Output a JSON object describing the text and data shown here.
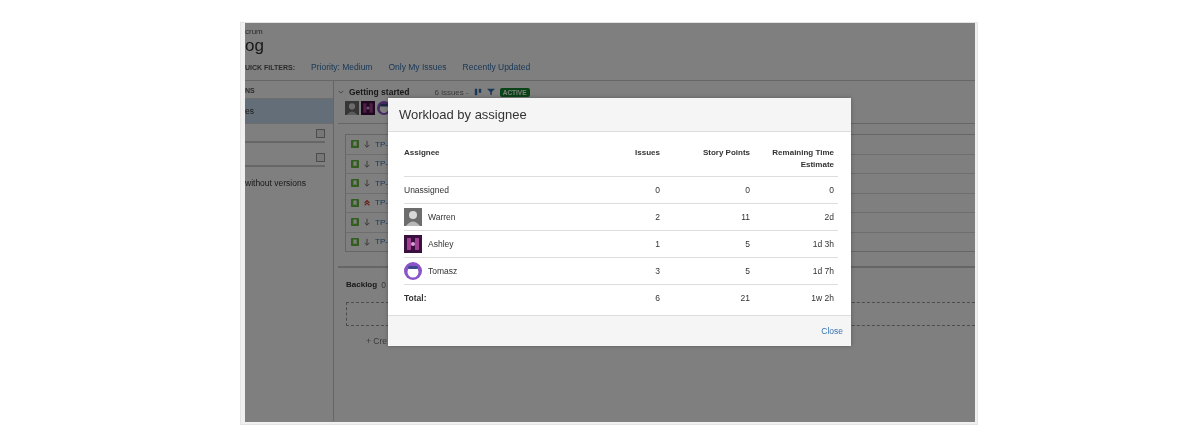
{
  "page": {
    "breadcrumb": "crum",
    "title": "og",
    "quick_filters_label": "UICK FILTERS:",
    "quick_filters": [
      "Priority: Medium",
      "Only My Issues",
      "Recently Updated"
    ]
  },
  "sidebar": {
    "header": "NS",
    "items": [
      {
        "label": "es",
        "selected": true
      }
    ],
    "footer_text": "without versions"
  },
  "sprint": {
    "name": "Getting started",
    "issue_count": "6 issues -",
    "status": "ACTIVE",
    "avatars": [
      {
        "kind": "photo"
      },
      {
        "kind": "art"
      },
      {
        "kind": "round"
      }
    ],
    "issues": [
      {
        "key": "TP-",
        "kind": "low"
      },
      {
        "key": "TP-",
        "kind": "low"
      },
      {
        "key": "TP-",
        "kind": "low"
      },
      {
        "key": "TP-",
        "kind": "highest"
      },
      {
        "key": "TP-",
        "kind": "low"
      },
      {
        "key": "TP-",
        "kind": "low"
      }
    ]
  },
  "backlog": {
    "label": "Backlog",
    "count": "0",
    "create_text": "+ Cre"
  },
  "dialog": {
    "title": "Workload by assignee",
    "columns": [
      "Assignee",
      "Issues",
      "Story Points",
      "Remaining Time Estimate"
    ],
    "rows": [
      {
        "kind": "none",
        "assignee": "Unassigned",
        "issues": "0",
        "story_points": "0",
        "remaining": "0"
      },
      {
        "kind": "photo",
        "assignee": "Warren",
        "issues": "2",
        "story_points": "11",
        "remaining": "2d"
      },
      {
        "kind": "art",
        "assignee": "Ashley",
        "issues": "1",
        "story_points": "5",
        "remaining": "1d 3h"
      },
      {
        "kind": "round",
        "assignee": "Tomasz",
        "issues": "3",
        "story_points": "5",
        "remaining": "1d 7h"
      }
    ],
    "total": {
      "label": "Total:",
      "issues": "6",
      "story_points": "21",
      "remaining": "1w 2h"
    },
    "close": "Close"
  }
}
